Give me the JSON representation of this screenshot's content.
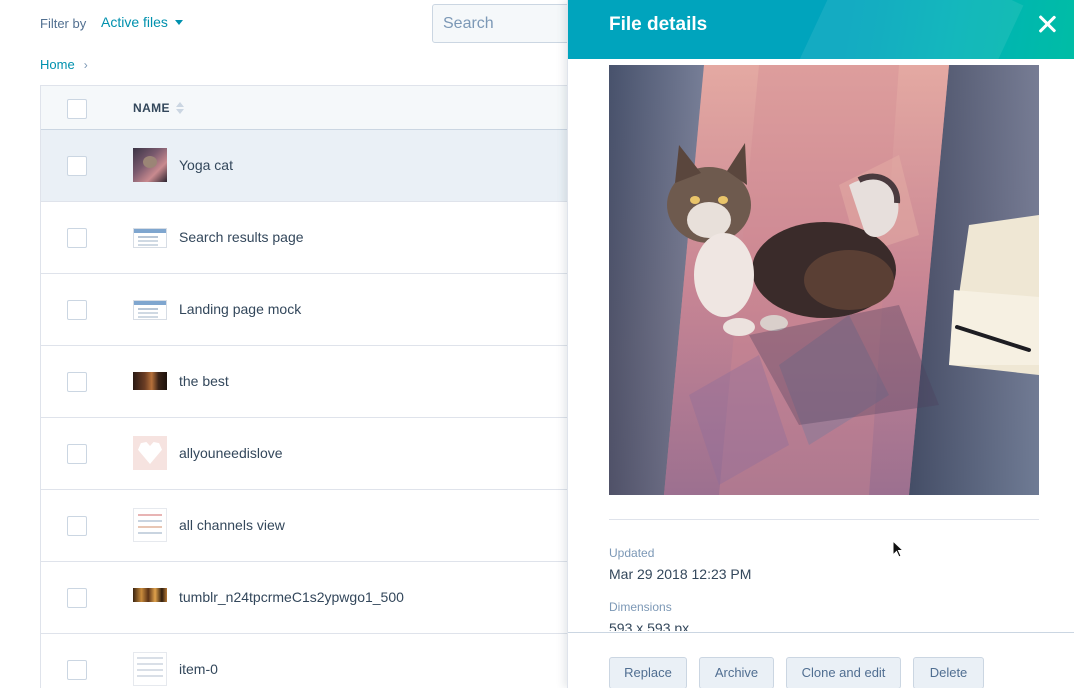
{
  "filter": {
    "label": "Filter by",
    "value": "Active files",
    "search_placeholder": "Search"
  },
  "breadcrumb": {
    "home": "Home",
    "separator": "›"
  },
  "table": {
    "column_name": "NAME",
    "rows": [
      {
        "name": "Yoga cat",
        "thumbnail": "cat-photo",
        "selected": true
      },
      {
        "name": "Search results page",
        "thumbnail": "screenshot"
      },
      {
        "name": "Landing page mock",
        "thumbnail": "screenshot"
      },
      {
        "name": "the best",
        "thumbnail": "dark-photo"
      },
      {
        "name": "allyouneedislove",
        "thumbnail": "heart-graphic"
      },
      {
        "name": "all channels view",
        "thumbnail": "document"
      },
      {
        "name": "tumblr_n24tpcrmeC1s2ypwgo1_500",
        "thumbnail": "warm-photo"
      },
      {
        "name": "item-0",
        "thumbnail": "document"
      }
    ]
  },
  "details": {
    "title": "File details",
    "updated_label": "Updated",
    "updated_value": "Mar 29 2018 12:23 PM",
    "dimensions_label": "Dimensions",
    "dimensions_value": "593 x 593 px",
    "buttons": {
      "replace": "Replace",
      "archive": "Archive",
      "clone": "Clone and edit",
      "delete": "Delete"
    }
  },
  "colors": {
    "accent": "#0091ae",
    "header_teal": "#00a4bd",
    "header_green": "#00bda5",
    "text": "#33475b",
    "muted": "#7c98b6",
    "selected_row": "#eaf0f6"
  }
}
